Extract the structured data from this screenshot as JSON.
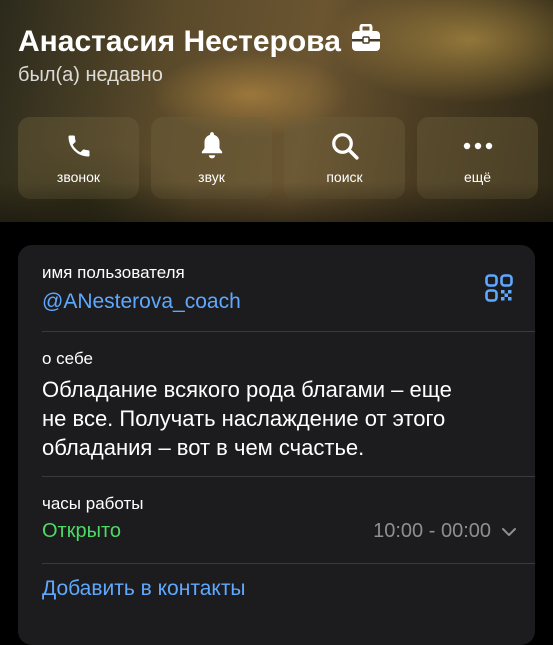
{
  "profile": {
    "name": "Анастасия Нестерова",
    "status": "был(а) недавно"
  },
  "actions": [
    {
      "label": "звонок",
      "icon": "phone-icon"
    },
    {
      "label": "звук",
      "icon": "bell-icon"
    },
    {
      "label": "поиск",
      "icon": "search-icon"
    },
    {
      "label": "ещё",
      "icon": "more-icon"
    }
  ],
  "info": {
    "username_label": "имя пользователя",
    "username": "@ANesterova_coach",
    "about_label": "о себе",
    "about_line1": "Обладание всякого рода благами – еще",
    "about_line2": "не все. Получать наслаждение от этого",
    "about_line3": "обладания – вот в чем счастье.",
    "hours_label": "часы работы",
    "hours_status": "Открыто",
    "hours_value": "10:00 - 00:00",
    "add_contact": "Добавить в контакты"
  },
  "colors": {
    "accent": "#5ea9ff",
    "open_green": "#4cd964",
    "card_bg": "#1c1c1e"
  }
}
